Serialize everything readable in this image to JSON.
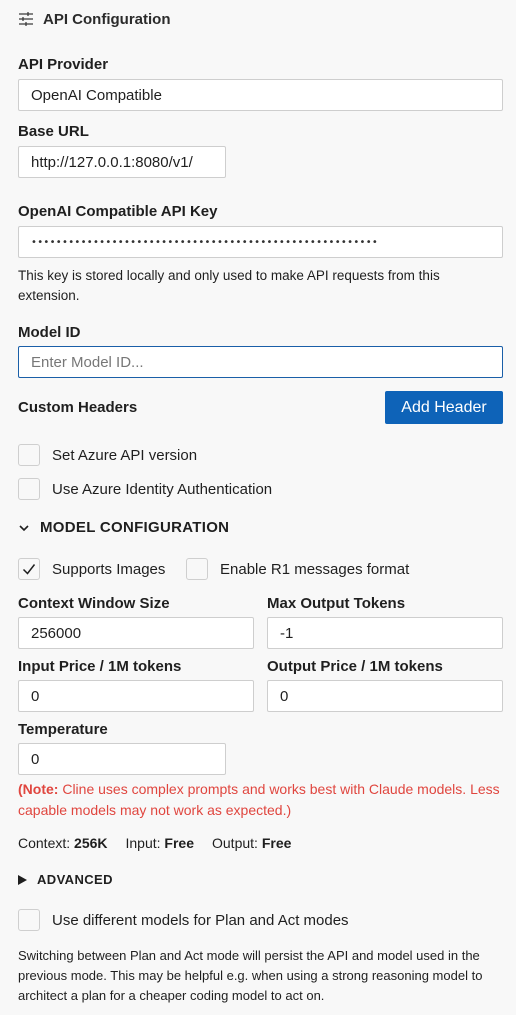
{
  "header": {
    "title": "API Configuration",
    "icon": "sliders-icon"
  },
  "provider": {
    "label": "API Provider",
    "value": "OpenAI Compatible"
  },
  "base_url": {
    "label": "Base URL",
    "value": "http://127.0.0.1:8080/v1/"
  },
  "api_key": {
    "label": "OpenAI Compatible API Key",
    "value": "••••••••••••••••••••••••••••••••••••••••••••••••••••••••",
    "help": "This key is stored locally and only used to make API requests from this extension."
  },
  "model_id": {
    "label": "Model ID",
    "placeholder": "Enter Model ID..."
  },
  "custom_headers": {
    "label": "Custom Headers",
    "button": "Add Header"
  },
  "azure": {
    "api_version": {
      "label": "Set Azure API version",
      "checked": false
    },
    "identity_auth": {
      "label": "Use Azure Identity Authentication",
      "checked": false
    }
  },
  "model_config": {
    "title": "MODEL CONFIGURATION",
    "supports_images": {
      "label": "Supports Images",
      "checked": true
    },
    "r1_format": {
      "label": "Enable R1 messages format",
      "checked": false
    },
    "context_window": {
      "label": "Context Window Size",
      "value": "256000"
    },
    "max_output": {
      "label": "Max Output Tokens",
      "value": "-1"
    },
    "input_price": {
      "label": "Input Price / 1M tokens",
      "value": "0"
    },
    "output_price": {
      "label": "Output Price / 1M tokens",
      "value": "0"
    },
    "temperature": {
      "label": "Temperature",
      "value": "0"
    }
  },
  "note": {
    "prefix": "(Note:",
    "text": " Cline uses complex prompts and works best with Claude models. Less capable models may not work as expected.)"
  },
  "stats": {
    "context_label": "Context:",
    "context_value": "256K",
    "input_label": "Input:",
    "input_value": "Free",
    "output_label": "Output:",
    "output_value": "Free"
  },
  "advanced": {
    "title": "ADVANCED"
  },
  "plan_act": {
    "label": "Use different models for Plan and Act modes",
    "checked": false,
    "help": "Switching between Plan and Act mode will persist the API and model used in the previous mode. This may be helpful e.g. when using a strong reasoning model to architect a plan for a cheaper coding model to act on."
  },
  "colors": {
    "accent": "#0e63b8",
    "warning": "#e0463f",
    "focus": "#1a5fa8"
  }
}
